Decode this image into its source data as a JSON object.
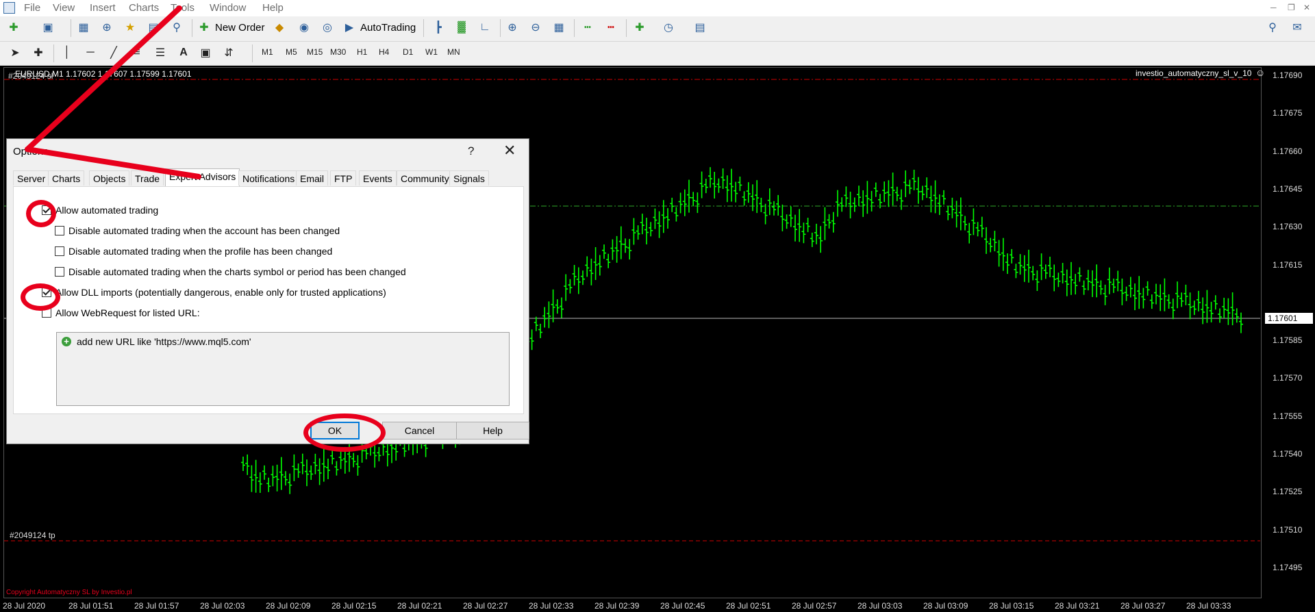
{
  "menu": {
    "file": "File",
    "view": "View",
    "insert": "Insert",
    "charts": "Charts",
    "tools": "Tools",
    "window": "Window",
    "help": "Help"
  },
  "toolbar": {
    "new_order": "New Order",
    "auto_trading": "AutoTrading",
    "timeframes": [
      "M1",
      "M5",
      "M15",
      "M30",
      "H1",
      "H4",
      "D1",
      "W1",
      "MN"
    ]
  },
  "chart": {
    "symbol_header": "EURUSD,M1  1.17602 1.17607 1.17599 1.17601",
    "order_label": "#2049124 sl",
    "tp_label": "#2049124 tp",
    "ea_name": "investio_automatyczny_sl_v_10",
    "copyright": "Copyright Automatyczny SL by Investio.pl",
    "current_price": "1.17601",
    "bar_color": "#00ff00",
    "price_labels": [
      "1.17690",
      "1.17675",
      "1.17660",
      "1.17645",
      "1.17630",
      "1.17615",
      "1.17601",
      "1.17585",
      "1.17570",
      "1.17555",
      "1.17540",
      "1.17525",
      "1.17510",
      "1.17495"
    ],
    "time_labels": [
      "28 Jul 2020",
      "28 Jul 01:51",
      "28 Jul 01:57",
      "28 Jul 02:03",
      "28 Jul 02:09",
      "28 Jul 02:15",
      "28 Jul 02:21",
      "28 Jul 02:27",
      "28 Jul 02:33",
      "28 Jul 02:39",
      "28 Jul 02:45",
      "28 Jul 02:51",
      "28 Jul 02:57",
      "28 Jul 03:03",
      "28 Jul 03:09",
      "28 Jul 03:15",
      "28 Jul 03:21",
      "28 Jul 03:27",
      "28 Jul 03:33"
    ]
  },
  "dialog": {
    "title": "Options",
    "help_glyph": "?",
    "close_glyph": "✕",
    "tabs": [
      "Server",
      "Charts",
      "Objects",
      "Trade",
      "Expert Advisors",
      "Notifications",
      "Email",
      "FTP",
      "Events",
      "Community",
      "Signals"
    ],
    "active_tab": "Expert Advisors",
    "options": [
      {
        "label": "Allow automated trading",
        "checked": true
      },
      {
        "label": "Disable automated trading when the account has been changed",
        "checked": false
      },
      {
        "label": "Disable automated trading when the profile has been changed",
        "checked": false
      },
      {
        "label": "Disable automated trading when the charts symbol or period has been changed",
        "checked": false
      },
      {
        "label": "Allow DLL imports (potentially dangerous, enable only for trusted applications)",
        "checked": true
      },
      {
        "label": "Allow WebRequest for listed URL:",
        "checked": false
      }
    ],
    "url_placeholder": "add new URL like 'https://www.mql5.com'",
    "ok": "OK",
    "cancel": "Cancel",
    "help": "Help"
  },
  "annotation_color": "#e8001c"
}
